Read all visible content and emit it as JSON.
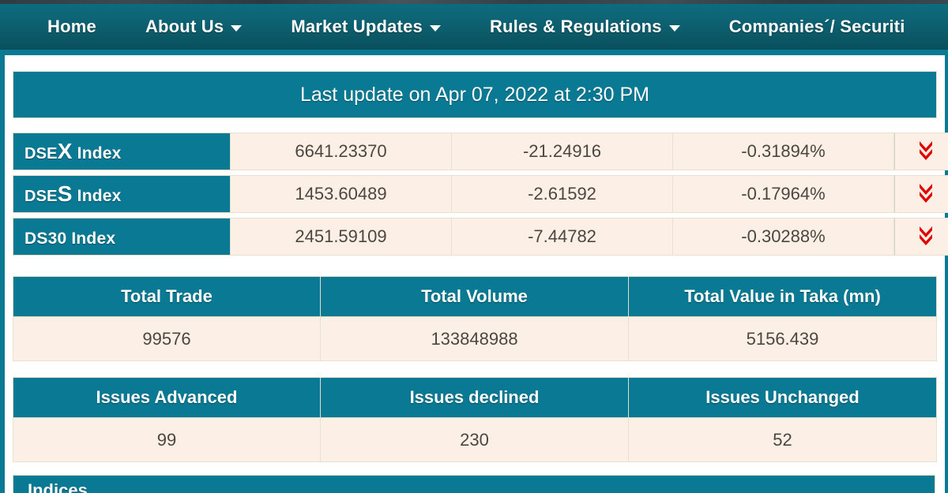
{
  "nav": {
    "items": [
      {
        "label": "Home",
        "has_caret": false
      },
      {
        "label": "About Us",
        "has_caret": true
      },
      {
        "label": "Market Updates",
        "has_caret": true
      },
      {
        "label": "Rules & Regulations",
        "has_caret": true
      },
      {
        "label": "Companies´/ Securiti",
        "has_caret": false
      }
    ]
  },
  "banner": {
    "last_update": "Last update on Apr 07, 2022 at 2:30 PM"
  },
  "indices": [
    {
      "name_prefix": "DSE",
      "name_big": "X",
      "name_suffix": " Index",
      "value": "6641.23370",
      "change": "-21.24916",
      "percent": "-0.31894%",
      "direction": "down",
      "arrow_icon": "double-chevron-down-icon"
    },
    {
      "name_prefix": "DSE",
      "name_big": "S",
      "name_suffix": " Index",
      "value": "1453.60489",
      "change": "-2.61592",
      "percent": "-0.17964%",
      "direction": "down",
      "arrow_icon": "double-chevron-down-icon"
    },
    {
      "name_prefix": "DS30 Index",
      "name_big": "",
      "name_suffix": "",
      "value": "2451.59109",
      "change": "-7.44782",
      "percent": "-0.30288%",
      "direction": "down",
      "arrow_icon": "double-chevron-down-icon"
    }
  ],
  "totals": {
    "headers": [
      "Total Trade",
      "Total Volume",
      "Total Value in Taka (mn)"
    ],
    "values": [
      "99576",
      "133848988",
      "5156.439"
    ]
  },
  "issues": {
    "headers": [
      "Issues Advanced",
      "Issues declined",
      "Issues Unchanged"
    ],
    "values": [
      "99",
      "230",
      "52"
    ]
  },
  "bottom_panel": {
    "title": "Indices"
  },
  "colors": {
    "teal": "#0a7a94",
    "nav_gradient_top": "#0e6b7f",
    "nav_gradient_bottom": "#0a4f5d",
    "cell_bg": "#fcf0e6",
    "cell_border": "#e6e2d2",
    "down_arrow_red": "#e00000",
    "text_dark": "#4b4740",
    "text_white": "#ffffff"
  }
}
